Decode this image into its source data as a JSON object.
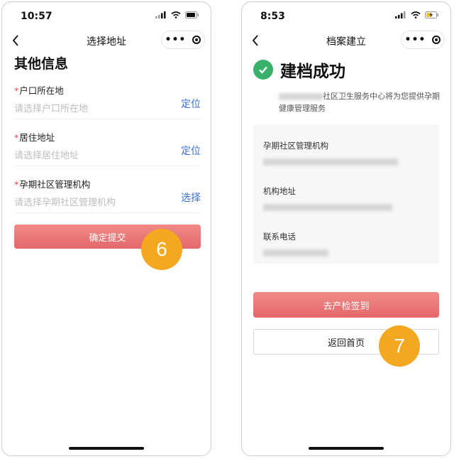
{
  "left_screen": {
    "status_time": "10:57",
    "nav_title": "选择地址",
    "section_title": "其他信息",
    "fields": [
      {
        "required_mark": "*",
        "label": "户口所在地",
        "placeholder": "请选择户口所在地",
        "action": "定位"
      },
      {
        "required_mark": "*",
        "label": "居住地址",
        "placeholder": "请选择居住地址",
        "action": "定位"
      },
      {
        "required_mark": "*",
        "label": "孕期社区管理机构",
        "placeholder": "请选择孕期社区管理机构",
        "action": "选择"
      }
    ],
    "submit_label": "确定提交",
    "step_badge": "6"
  },
  "right_screen": {
    "status_time": "8:53",
    "nav_title": "档案建立",
    "success_title": "建档成功",
    "notice_text": "社区卫生服务中心将为您提供孕期健康管理服务",
    "info_labels": [
      "孕期社区管理机构",
      "机构地址",
      "联系电话"
    ],
    "primary_button": "去产检签到",
    "secondary_button": "返回首页",
    "step_badge": "7"
  },
  "colors": {
    "primary_button": "#e4676a",
    "link_blue": "#3a6fd1",
    "success_green": "#3ab16a",
    "badge_orange": "#f4a820",
    "required_red": "#e8433f"
  },
  "icons": [
    "back-chevron-icon",
    "more-dots-icon",
    "target-circle-icon",
    "signal-icon",
    "wifi-icon",
    "battery-icon",
    "check-circle-icon"
  ]
}
